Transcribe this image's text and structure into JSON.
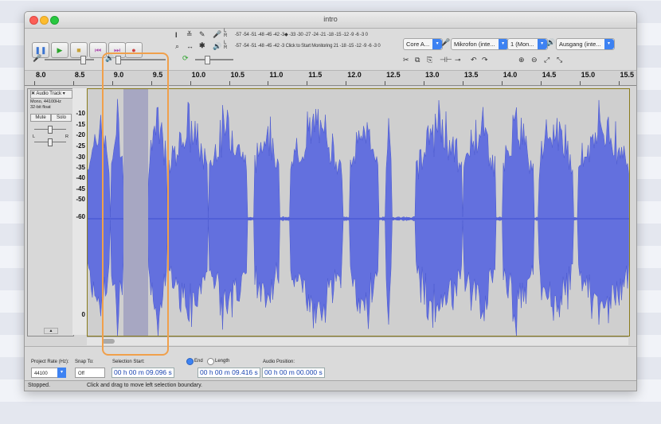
{
  "window": {
    "title": "intro"
  },
  "transport": {
    "buttons": [
      {
        "name": "pause-button",
        "glyph": "❚❚",
        "color": "#3b74d1"
      },
      {
        "name": "play-button",
        "glyph": "▶",
        "color": "#2aa32a"
      },
      {
        "name": "stop-button",
        "glyph": "■",
        "color": "#c8a23a"
      },
      {
        "name": "skip-start-button",
        "glyph": "⏮",
        "color": "#b04fb0"
      },
      {
        "name": "skip-end-button",
        "glyph": "⏭",
        "color": "#b04fb0"
      },
      {
        "name": "record-button",
        "glyph": "●",
        "color": "#d04040"
      }
    ]
  },
  "meters": {
    "record_scale": "-57 -54 -51 -48 -45 -42 -3◆ -33 -30 -27 -24 -21 -18 -15 -12 -9 -6 -3 0",
    "play_scale": "-57 -54 -51 -48 -45 -42 -3 Click to Start Monitoring 21 -18 -15 -12 -9 -6 -3 0",
    "channel_labels": [
      "L",
      "R"
    ]
  },
  "devices": {
    "host": "Core A...",
    "input": "Mikrofon (inte...",
    "channels": "1 (Mon...",
    "output": "Ausgang (inte..."
  },
  "ruler": {
    "ticks": [
      "8.0",
      "8.5",
      "9.0",
      "9.5",
      "10.0",
      "10.5",
      "11.0",
      "11.5",
      "12.0",
      "12.5",
      "13.0",
      "13.5",
      "14.0",
      "14.5",
      "15.0",
      "15.5"
    ]
  },
  "track": {
    "name": "Audio Track",
    "info": [
      "Mono, 44100Hz",
      "32-bit float"
    ],
    "mute_label": "Mute",
    "solo_label": "Solo",
    "pan_labels": [
      "L",
      "R"
    ],
    "db_scale": [
      "0",
      "-10",
      "-15",
      "-20",
      "-25",
      "-30",
      "-35",
      "-40",
      "-45",
      "-50",
      "-60"
    ],
    "wave_color": "#5a68e0"
  },
  "selection_toolbar": {
    "project_rate_label": "Project Rate (Hz):",
    "project_rate_value": "44100",
    "snap_label": "Snap To:",
    "snap_value": "Off",
    "selection_start_label": "Selection Start:",
    "end_label": "End",
    "length_label": "Length",
    "selection_start_value": "00 h 00 m 09.096 s",
    "selection_end_value": "00 h 00 m 09.416 s",
    "audio_position_label": "Audio Position:",
    "audio_position_value": "00 h 00 m 00.000 s"
  },
  "status": {
    "state": "Stopped.",
    "hint": "Click and drag to move left selection boundary."
  },
  "highlight_color": "#f0a04b"
}
